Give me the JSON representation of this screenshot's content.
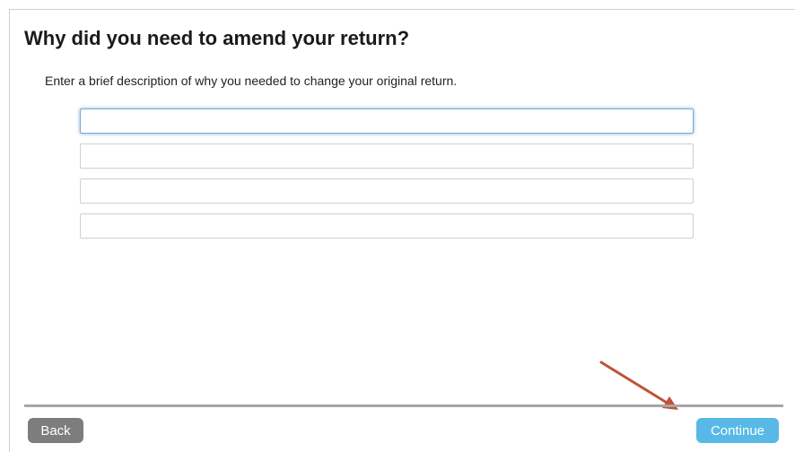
{
  "page": {
    "title": "Why did you need to amend your return?",
    "instructions": "Enter a brief description of why you needed to change your original return."
  },
  "description_lines": [
    {
      "value": "",
      "focused": true
    },
    {
      "value": "",
      "focused": false
    },
    {
      "value": "",
      "focused": false
    },
    {
      "value": "",
      "focused": false
    }
  ],
  "footer": {
    "back_label": "Back",
    "continue_label": "Continue"
  },
  "colors": {
    "continue_button": "#58b9e6",
    "back_button": "#7d7d7d",
    "annotation_arrow": "#c0503a",
    "focus_ring": "#7aa7dc"
  }
}
